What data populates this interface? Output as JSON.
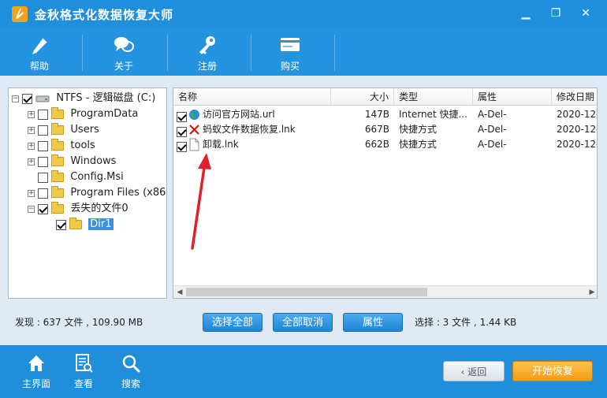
{
  "window": {
    "title": "金秋格式化数据恢复大师",
    "minimize_glyph": "▁",
    "restore_glyph": "❐",
    "close_glyph": "✕"
  },
  "toolbar": {
    "help_label": "帮助",
    "about_label": "关于",
    "register_label": "注册",
    "buy_label": "购买"
  },
  "tree": {
    "root_label": "NTFS - 逻辑磁盘 (C:)",
    "items": [
      {
        "label": "ProgramData",
        "checked": false
      },
      {
        "label": "Users",
        "checked": false
      },
      {
        "label": "tools",
        "checked": false
      },
      {
        "label": "Windows",
        "checked": false
      },
      {
        "label": "Config.Msi",
        "checked": false
      },
      {
        "label": "Program Files (x86)",
        "checked": false
      },
      {
        "label": "丢失的文件0",
        "checked": true
      },
      {
        "label": "Dir1",
        "checked": true
      }
    ]
  },
  "list": {
    "columns": [
      "名称",
      "大小",
      "类型",
      "属性",
      "修改日期"
    ],
    "rows": [
      {
        "name": "访问官方网站.url",
        "size": "147B",
        "type": "Internet 快捷...",
        "attr": "A-Del-",
        "date": "2020-12-",
        "icon": "globe-icon"
      },
      {
        "name": "蚂蚁文件数据恢复.lnk",
        "size": "667B",
        "type": "快捷方式",
        "attr": "A-Del-",
        "date": "2020-12-",
        "icon": "red-x-icon"
      },
      {
        "name": "卸载.lnk",
        "size": "662B",
        "type": "快捷方式",
        "attr": "A-Del-",
        "date": "2020-12-",
        "icon": "document-icon"
      }
    ]
  },
  "status": {
    "found_text": "发现 : 637 文件 , 109.90 MB",
    "selected_text": "选择 : 3 文件 , 1.44 KB"
  },
  "actions": {
    "select_all": "选择全部",
    "deselect_all": "全部取消",
    "properties": "属性"
  },
  "bottom": {
    "home_label": "主界面",
    "view_label": "查看",
    "search_label": "搜索",
    "back_label": "返回",
    "start_label": "开始恢复"
  },
  "colors": {
    "titlebar": "#1f8fdc",
    "toolbar": "#2494e0",
    "button_blue": "#1b86d6",
    "start_orange": "#f29a12",
    "arrow_red": "#e0202a"
  }
}
